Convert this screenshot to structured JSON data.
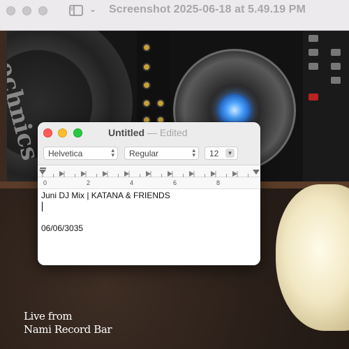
{
  "preview_window": {
    "title": "Screenshot 2025-06-18 at 5.49.19 PM",
    "chevron": "⌄",
    "icons": [
      "sidebar-toggle-icon",
      "chevron-down-icon"
    ]
  },
  "photo": {
    "caption_line1": "Live from",
    "caption_line2": "Nami Record Bar"
  },
  "textedit": {
    "title": "Untitled",
    "separator": "—",
    "status": "Edited",
    "toolbar": {
      "font": "Helvetica",
      "style": "Regular",
      "size": "12"
    },
    "ruler_labels": [
      "0",
      "2",
      "4",
      "6",
      "8"
    ],
    "document": {
      "line1": "Juni DJ Mix | KATANA & FRIENDS",
      "line3": "06/06/3035"
    }
  },
  "colors": {
    "close": "#fe5f57",
    "minimize": "#febc2e",
    "zoom": "#28c840",
    "jog_light": "#4ba3ff"
  }
}
